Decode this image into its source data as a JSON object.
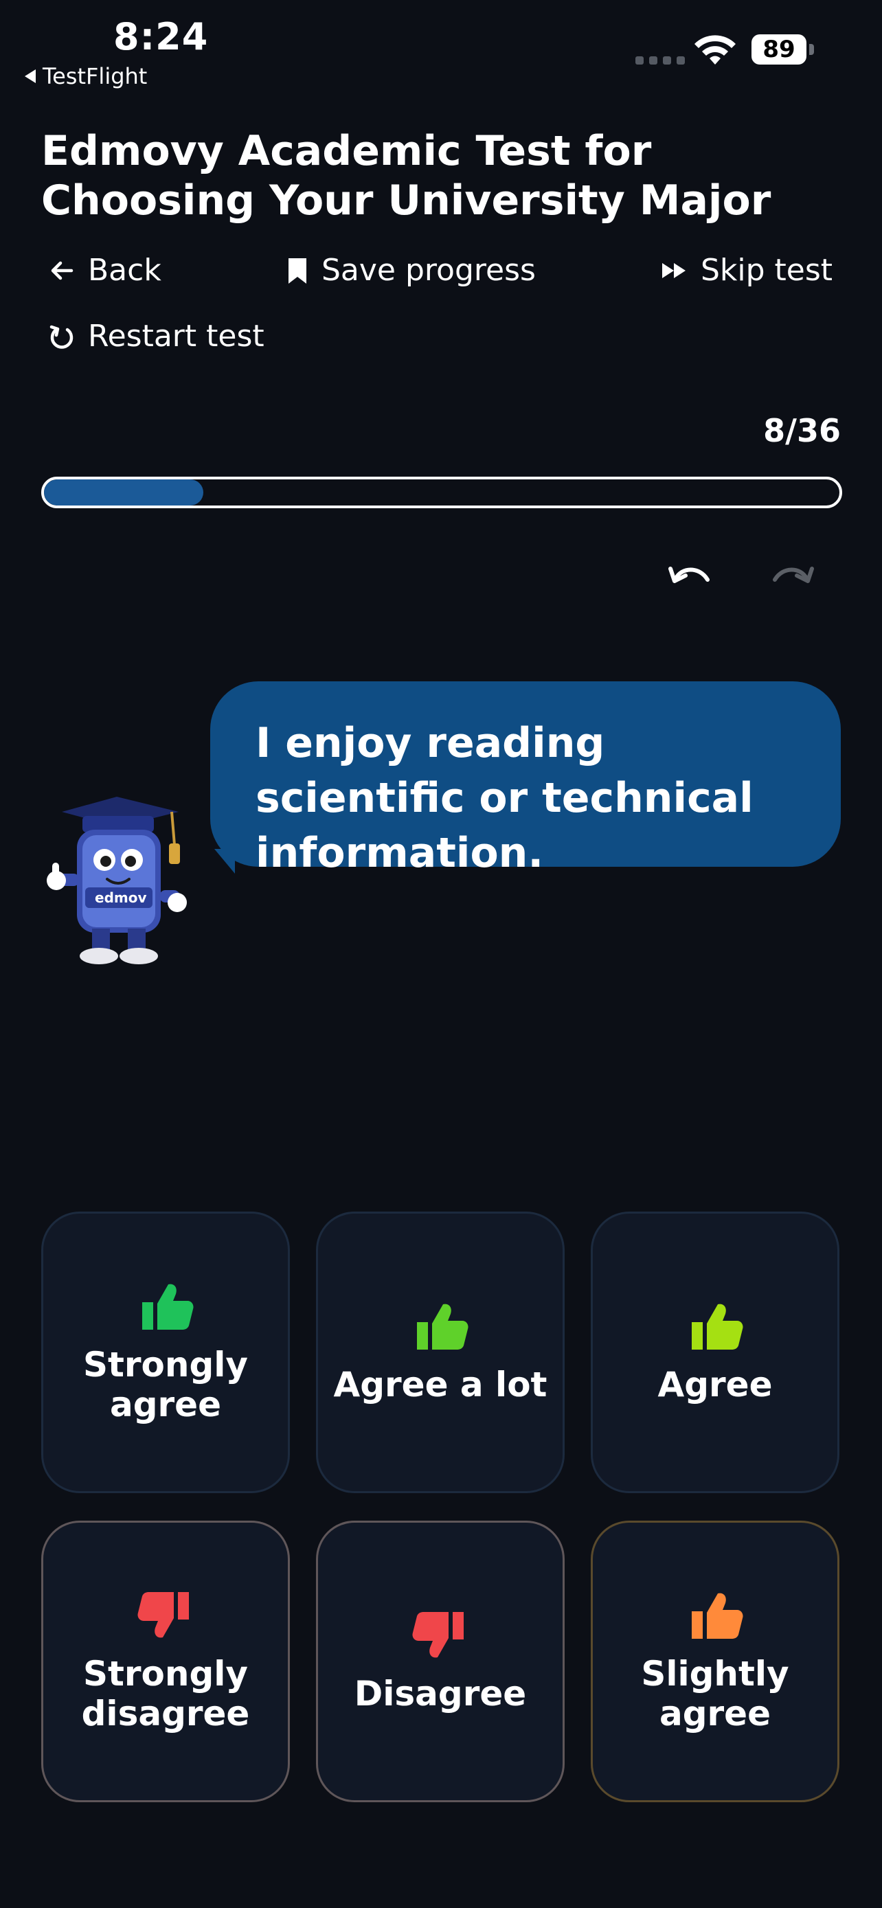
{
  "status_bar": {
    "time": "8:24",
    "back_app": "TestFlight",
    "battery": "89",
    "icons": [
      "cellular-signal-icon",
      "wifi-icon",
      "battery-icon"
    ]
  },
  "title": "Edmovy Academic Test for Choosing Your University Major",
  "toolbar": {
    "back_label": "Back",
    "save_label": "Save progress",
    "skip_label": "Skip test",
    "restart_label": "Restart test",
    "icons": [
      "arrow-left-icon",
      "bookmark-icon",
      "fast-forward-icon",
      "restart-icon"
    ]
  },
  "progress": {
    "current": 8,
    "total": 36,
    "text": "8/36",
    "fill_fraction": 0.2
  },
  "history_controls": {
    "icons": [
      "undo-icon",
      "redo-icon"
    ],
    "redo_enabled": false
  },
  "mascot": {
    "badge_text": "edmov"
  },
  "question": {
    "text": "I enjoy reading scientific or technical information."
  },
  "answers": [
    {
      "label": "Strongly\nagree",
      "icon": "thumbs-up-icon",
      "color": "#1fc25a"
    },
    {
      "label": "Agree a lot",
      "icon": "thumbs-up-icon",
      "color": "#5fd12a"
    },
    {
      "label": "Agree",
      "icon": "thumbs-up-icon",
      "color": "#a5e012"
    },
    {
      "label": "Strongly\ndisagree",
      "icon": "thumbs-down-icon",
      "color": "#f0464a"
    },
    {
      "label": "Disagree",
      "icon": "thumbs-down-icon",
      "color": "#f0464a"
    },
    {
      "label": "Slightly\nagree",
      "icon": "thumbs-up-icon",
      "color": "#ff8a3a"
    }
  ],
  "colors": {
    "background": "#0c0f16",
    "accent": "#1b5a98",
    "bubble": "#0f4d84",
    "card": "#111826"
  }
}
